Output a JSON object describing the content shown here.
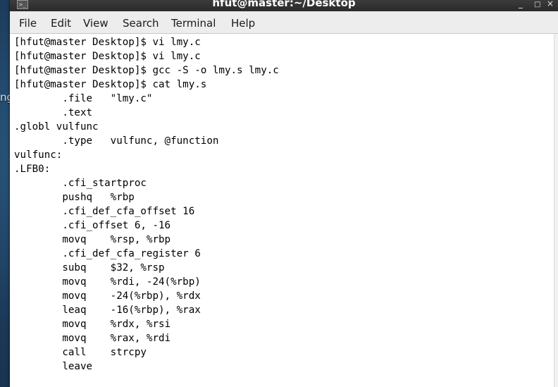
{
  "window": {
    "title": "hfut@master:~/Desktop",
    "controls": {
      "minimize": "_",
      "maximize": "□",
      "close": "×"
    },
    "icon": "terminal-icon"
  },
  "desktop": {
    "fragment_text": "ng"
  },
  "menubar": {
    "items": [
      "File",
      "Edit",
      "View",
      "Search",
      "Terminal",
      "Help"
    ]
  },
  "terminal": {
    "lines": [
      "[hfut@master Desktop]$ vi lmy.c",
      "[hfut@master Desktop]$ vi lmy.c",
      "[hfut@master Desktop]$ gcc -S -o lmy.s lmy.c",
      "[hfut@master Desktop]$ cat lmy.s",
      "        .file   \"lmy.c\"",
      "        .text",
      ".globl vulfunc",
      "        .type   vulfunc, @function",
      "vulfunc:",
      ".LFB0:",
      "        .cfi_startproc",
      "        pushq   %rbp",
      "        .cfi_def_cfa_offset 16",
      "        .cfi_offset 6, -16",
      "        movq    %rsp, %rbp",
      "        .cfi_def_cfa_register 6",
      "        subq    $32, %rsp",
      "        movq    %rdi, -24(%rbp)",
      "        movq    -24(%rbp), %rdx",
      "        leaq    -16(%rbp), %rax",
      "        movq    %rdx, %rsi",
      "        movq    %rax, %rdi",
      "        call    strcpy",
      "        leave"
    ]
  }
}
